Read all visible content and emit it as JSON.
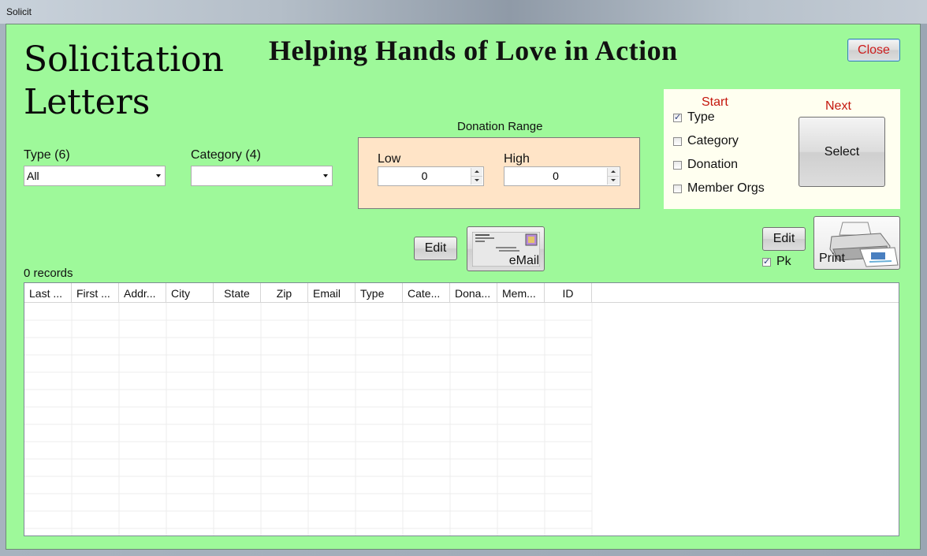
{
  "window": {
    "title": "Solicit"
  },
  "form": {
    "title_line1": "Solicitation",
    "title_line2": "Letters"
  },
  "org": {
    "name": "Helping Hands of Love in Action"
  },
  "close_label": "Close",
  "filters": {
    "type_label": "Type (6)",
    "type_value": "All",
    "category_label": "Category (4)",
    "category_value": ""
  },
  "donation_range": {
    "title": "Donation Range",
    "low_label": "Low",
    "low_value": "0",
    "high_label": "High",
    "high_value": "0"
  },
  "selection": {
    "start_label": "Start",
    "next_label": "Next",
    "select_label": "Select",
    "options": [
      {
        "label": "Type",
        "checked": true
      },
      {
        "label": "Category",
        "checked": false
      },
      {
        "label": "Donation",
        "checked": false
      },
      {
        "label": "Member Orgs",
        "checked": false
      }
    ]
  },
  "email": {
    "edit_label": "Edit",
    "button_label": "eMail"
  },
  "print": {
    "edit_label": "Edit",
    "pk_label": "Pk",
    "pk_checked": true,
    "button_label": "Print"
  },
  "records_label": "0 records",
  "grid": {
    "columns": [
      "Last ...",
      "First ...",
      "Addr...",
      "City",
      "State",
      "Zip",
      "Email",
      "Type",
      "Cate...",
      "Dona...",
      "Mem...",
      "ID"
    ]
  },
  "colors": {
    "background": "#9ef99a",
    "range_box": "#ffe4c7",
    "panel": "#fffff0",
    "accent_red": "#c4160c"
  }
}
